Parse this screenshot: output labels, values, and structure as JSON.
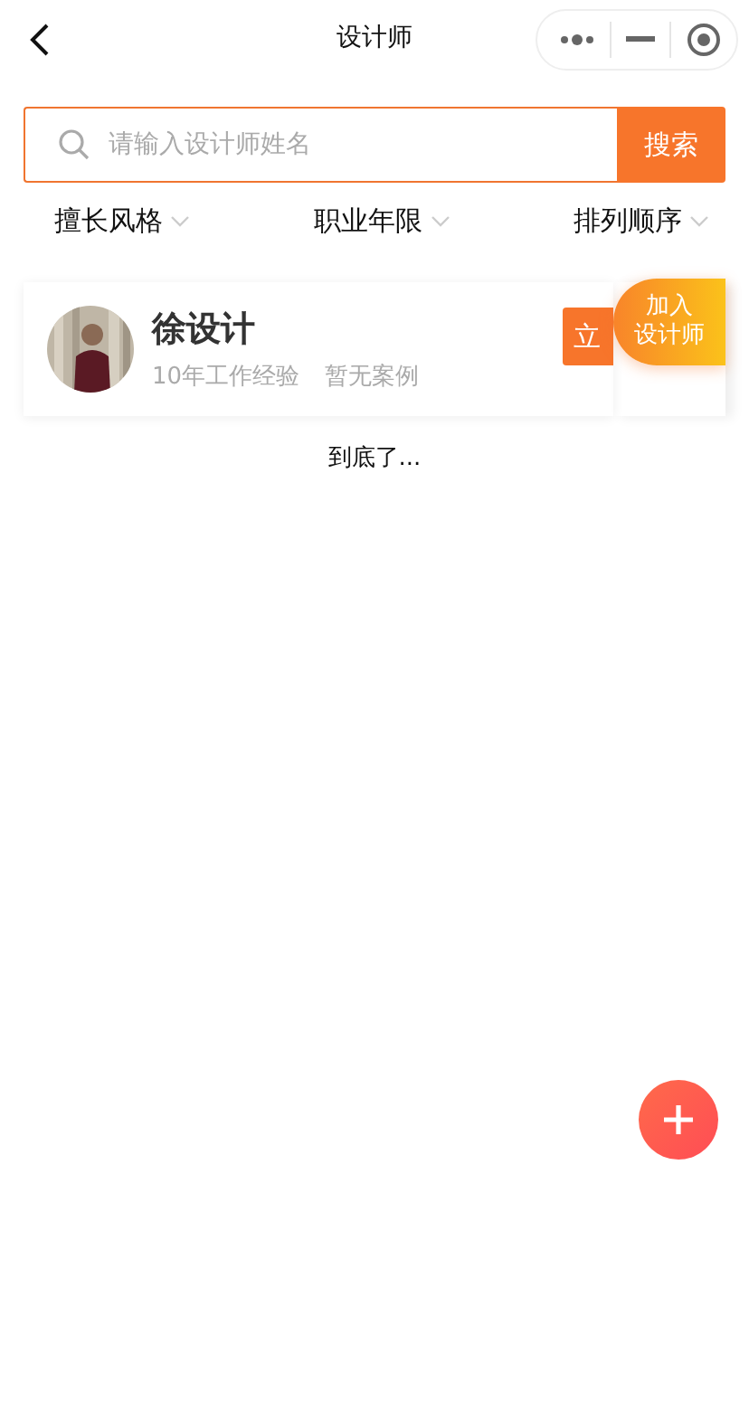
{
  "nav": {
    "title": "设计师"
  },
  "search": {
    "placeholder": "请输入设计师姓名",
    "button": "搜索"
  },
  "filters": [
    {
      "label": "擅长风格"
    },
    {
      "label": "职业年限"
    },
    {
      "label": "排列顺序"
    }
  ],
  "designers": [
    {
      "name": "徐设计",
      "experience": "10年工作经验",
      "cases": "暂无案例",
      "action": "立"
    }
  ],
  "end_text": "到底了...",
  "join_badge": [
    "加入",
    "设计师"
  ]
}
